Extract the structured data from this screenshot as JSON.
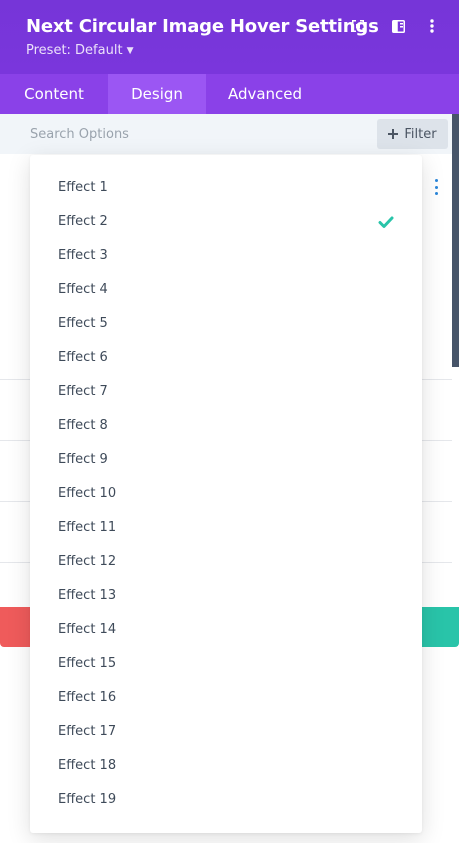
{
  "header": {
    "title": "Next Circular Image Hover Settings",
    "preset_label": "Preset: Default",
    "icons": [
      "expand-icon",
      "sidebar-toggle-icon",
      "more-vertical-icon"
    ]
  },
  "tabs": [
    {
      "label": "Content",
      "active": false
    },
    {
      "label": "Design",
      "active": true
    },
    {
      "label": "Advanced",
      "active": false
    }
  ],
  "search": {
    "placeholder": "Search Options",
    "filter_label": "Filter"
  },
  "dropdown": {
    "selected": "Effect 2",
    "items": [
      "Effect 1",
      "Effect 2",
      "Effect 3",
      "Effect 4",
      "Effect 5",
      "Effect 6",
      "Effect 7",
      "Effect 8",
      "Effect 9",
      "Effect 10",
      "Effect 11",
      "Effect 12",
      "Effect 13",
      "Effect 14",
      "Effect 15",
      "Effect 16",
      "Effect 17",
      "Effect 18",
      "Effect 19"
    ]
  },
  "colors": {
    "header_bg": "#7a36dc",
    "tabs_bg": "#8a41e8",
    "active_tab_bg": "#9b56f3",
    "check_color": "#29c4a9",
    "cancel_color": "#ef5b5b",
    "save_color": "#29c4a9"
  }
}
